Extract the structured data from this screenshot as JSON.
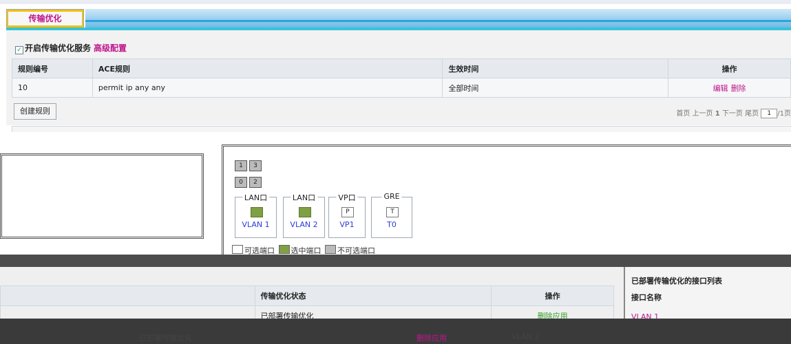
{
  "tab": {
    "label": "传输优化"
  },
  "service": {
    "enable_label": "开启传输优化服务",
    "enabled": true,
    "advanced_label": "高级配置"
  },
  "rules_table": {
    "headers": [
      "规则编号",
      "ACE规则",
      "生效时间",
      "操作"
    ],
    "rows": [
      {
        "id": "10",
        "ace": "permit ip any any",
        "time": "全部时间",
        "edit": "编辑",
        "delete": "删除"
      }
    ]
  },
  "create_rule_label": "创建规则",
  "pager": {
    "first": "首页",
    "prev": "上一页",
    "current": "1",
    "next": "下一页",
    "last": "尾页",
    "jump_value": "1",
    "total": "/1页"
  },
  "port_panel": {
    "ports_row1": [
      "1",
      "3"
    ],
    "ports_row2": [
      "0",
      "2"
    ],
    "groups": [
      {
        "label": "LAN口",
        "icon": "lan-port-icon",
        "state": "selected",
        "name": "VLAN 1"
      },
      {
        "label": "LAN口",
        "icon": "lan-port-icon",
        "state": "selected",
        "name": "VLAN 2"
      },
      {
        "label": "VP口",
        "icon": "vp-port-icon",
        "state": "selectable",
        "mark": "P",
        "name": "VP1"
      },
      {
        "label": "GRE",
        "icon": "gre-port-icon",
        "state": "selectable",
        "mark": "T",
        "name": "T0"
      }
    ],
    "legend": {
      "selectable": "可选端口",
      "selected": "选中端口",
      "unselectable": "不可选端口"
    }
  },
  "status_table": {
    "headers": [
      "传输优化状态",
      "操作"
    ],
    "row": {
      "status": "已部署传输优化",
      "action": "删除应用"
    }
  },
  "deployed_list": {
    "title": "已部署传输优化的接口列表",
    "header": "接口名称",
    "cell": "VLAN 1"
  },
  "bottom_row": {
    "status": "已部署传输优化",
    "action": "删除应用",
    "interface": "VLAN 2"
  },
  "colors": {
    "accent": "#c0168c",
    "selected_port": "#7fa043",
    "tab_band": "#2ba4dc"
  }
}
